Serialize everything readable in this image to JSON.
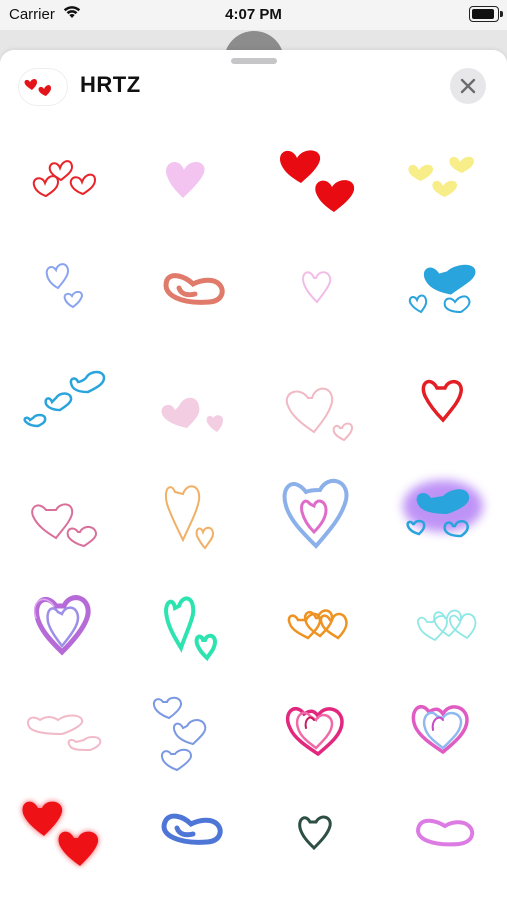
{
  "status_bar": {
    "carrier": "Carrier",
    "time": "4:07 PM"
  },
  "app": {
    "title": "HRTZ",
    "logo_icon": "two-red-hearts-icon",
    "close_icon": "close-icon"
  },
  "stickers": [
    {
      "icon": "three-red-outline-hearts-icon",
      "color": "#e8242a"
    },
    {
      "icon": "pink-heart-icon",
      "color": "#f2c4ef"
    },
    {
      "icon": "two-red-filled-hearts-icon",
      "color": "#e90b12"
    },
    {
      "icon": "three-yellow-hearts-icon",
      "color": "#f7ee8a"
    },
    {
      "icon": "two-blue-outline-hearts-icon",
      "color": "#8aa3ef"
    },
    {
      "icon": "salmon-brush-heart-icon",
      "color": "#e07a6a"
    },
    {
      "icon": "light-pink-outline-heart-icon",
      "color": "#f1bde6"
    },
    {
      "icon": "blue-hearts-cluster-icon",
      "color": "#2aa4dc"
    },
    {
      "icon": "three-blue-hearts-icon",
      "color": "#2aa4dc"
    },
    {
      "icon": "two-pale-pink-hearts-icon",
      "color": "#f3cde1"
    },
    {
      "icon": "two-pink-outline-hearts-icon",
      "color": "#f0b9c3"
    },
    {
      "icon": "red-outline-heart-icon",
      "color": "#e31e25"
    },
    {
      "icon": "two-rose-outline-hearts-icon",
      "color": "#d9709a"
    },
    {
      "icon": "two-orange-outline-hearts-icon",
      "color": "#f0b066"
    },
    {
      "icon": "blue-pink-nested-heart-icon",
      "color": "#8bb0ea"
    },
    {
      "icon": "glowing-blue-hearts-icon",
      "color": "#2aa4dc"
    },
    {
      "icon": "purple-layered-heart-icon",
      "color": "#a65ad0"
    },
    {
      "icon": "two-teal-hearts-icon",
      "color": "#2de3b0"
    },
    {
      "icon": "orange-linked-hearts-icon",
      "color": "#ee9322"
    },
    {
      "icon": "aqua-linked-hearts-icon",
      "color": "#8fe7e5"
    },
    {
      "icon": "two-pale-pink-outline-hearts-icon",
      "color": "#f2b9c9"
    },
    {
      "icon": "three-blue-outline-hearts-icon",
      "color": "#7b98e3"
    },
    {
      "icon": "magenta-scribble-heart-icon",
      "color": "#e2277f"
    },
    {
      "icon": "pink-blue-scribble-heart-icon",
      "color": "#e05cc2"
    },
    {
      "icon": "two-red-glow-hearts-icon",
      "color": "#ee1115"
    },
    {
      "icon": "blue-brush-heart-icon",
      "color": "#4e76d6"
    },
    {
      "icon": "dark-green-outline-heart-icon",
      "color": "#2d4f44"
    },
    {
      "icon": "violet-brush-heart-icon",
      "color": "#dd7be4"
    }
  ]
}
